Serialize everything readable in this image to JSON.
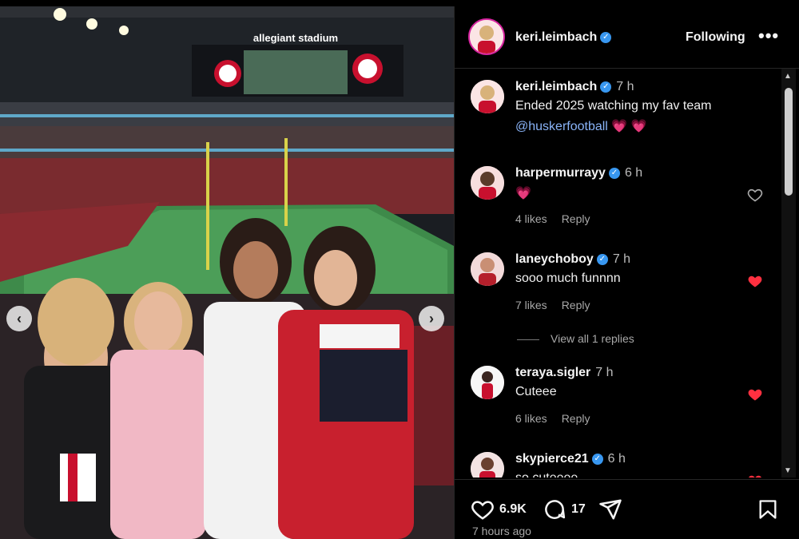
{
  "post": {
    "image_scoreboard_text": "allegiant stadium",
    "author": "keri.leimbach",
    "follow_label": "Following",
    "more_label": "•••",
    "caption": {
      "author": "keri.leimbach",
      "time": "7 h",
      "text": "Ended 2025 watching my fav team",
      "mention": "@huskerfootball",
      "emoji": "💗 💗"
    },
    "likes_count": "6.9K",
    "comments_count": "17",
    "posted_ago": "7 hours ago"
  },
  "comments": [
    {
      "user": "harpermurrayy",
      "verified": true,
      "time": "6 h",
      "text": "💗",
      "likes": "4 likes",
      "reply": "Reply",
      "liked": false
    },
    {
      "user": "laneychoboy",
      "verified": true,
      "time": "7 h",
      "text": "sooo much funnnn",
      "likes": "7 likes",
      "reply": "Reply",
      "liked": true,
      "view_replies": "View all 1 replies"
    },
    {
      "user": "teraya.sigler",
      "verified": false,
      "time": "7 h",
      "text": "Cuteee",
      "likes": "6 likes",
      "reply": "Reply",
      "liked": true
    },
    {
      "user": "skypierce21",
      "verified": true,
      "time": "6 h",
      "text": "so cuteeee",
      "liked": true
    }
  ],
  "colors": {
    "accent_heart": "#ff3040",
    "mention": "#8ab4f8",
    "verified": "#3897f0"
  },
  "icons": [
    "heart-icon",
    "comment-icon",
    "share-icon",
    "bookmark-icon",
    "chevron-left-icon",
    "chevron-right-icon",
    "verified-icon"
  ]
}
